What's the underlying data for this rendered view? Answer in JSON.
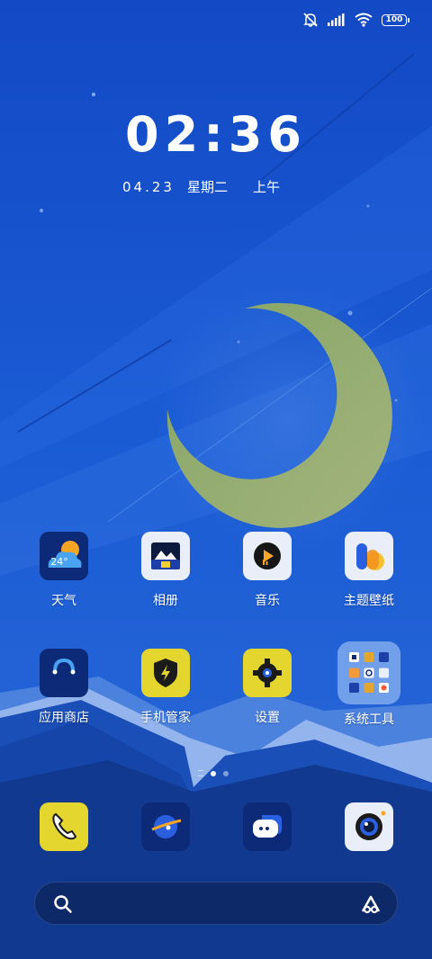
{
  "status_bar": {
    "battery": "100"
  },
  "lockclock": {
    "time": "02:36",
    "date": "04.23",
    "weekday": "星期二",
    "period": "上午"
  },
  "apps_row1": [
    {
      "label": "天气",
      "temp": "24°"
    },
    {
      "label": "相册"
    },
    {
      "label": "音乐"
    },
    {
      "label": "主题壁纸"
    }
  ],
  "apps_row2": [
    {
      "label": "应用商店"
    },
    {
      "label": "手机管家"
    },
    {
      "label": "设置"
    },
    {
      "label": "系统工具"
    }
  ],
  "dock": [
    {
      "icon": "phone-icon"
    },
    {
      "icon": "browser-icon"
    },
    {
      "icon": "messages-icon"
    },
    {
      "icon": "camera-icon"
    }
  ],
  "search_bar": {
    "left_icon": "search-icon",
    "right_icon": "assistant-icon"
  },
  "colors": {
    "sky": "#1553c7",
    "moon": "#9aad6a",
    "yellow": "#e4d62f",
    "navy": "#0e2a6e"
  }
}
